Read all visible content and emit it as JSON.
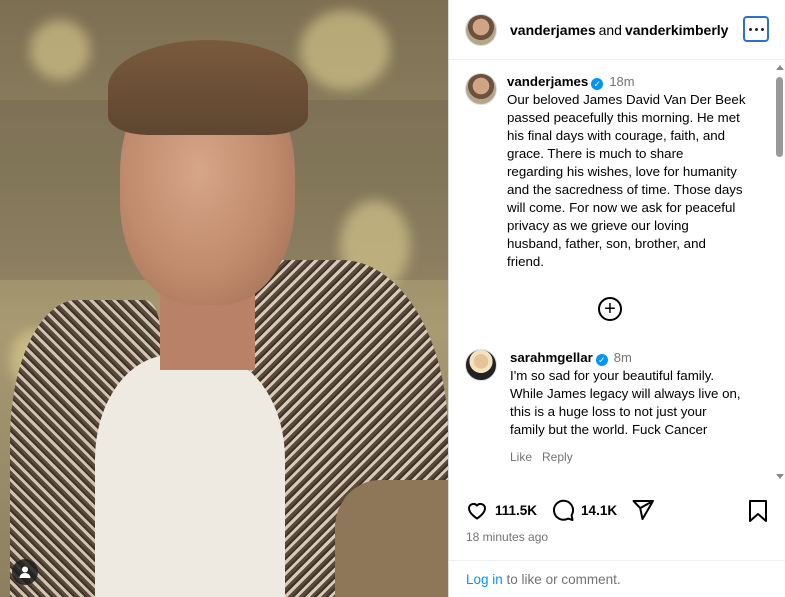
{
  "header": {
    "user1": "vanderjames",
    "conjunction": "and",
    "user2": "vanderkimberly"
  },
  "caption": {
    "username": "vanderjames",
    "time": "18m",
    "text": "Our beloved James David Van Der Beek\npassed peacefully this morning.  He met\nhis final days with courage, faith, and\ngrace.  There is much to share\nregarding his wishes, love for humanity\nand the sacredness of time.  Those days\nwill come.  For now we ask for peaceful\nprivacy as we grieve our loving\nhusband, father, son, brother, and\nfriend."
  },
  "comment": {
    "username": "sarahmgellar",
    "time": "8m",
    "text": "I'm so sad for your beautiful family.\nWhile James legacy will always live on,\nthis is a huge loss to not just your\nfamily but the world. Fuck Cancer",
    "like_label": "Like",
    "reply_label": "Reply"
  },
  "stats": {
    "likes": "111.5K",
    "comments": "14.1K"
  },
  "posted_ago": "18 minutes ago",
  "login": {
    "link": "Log in",
    "rest": " to like or comment."
  },
  "icons": {
    "verified_color": "#0095f6"
  }
}
